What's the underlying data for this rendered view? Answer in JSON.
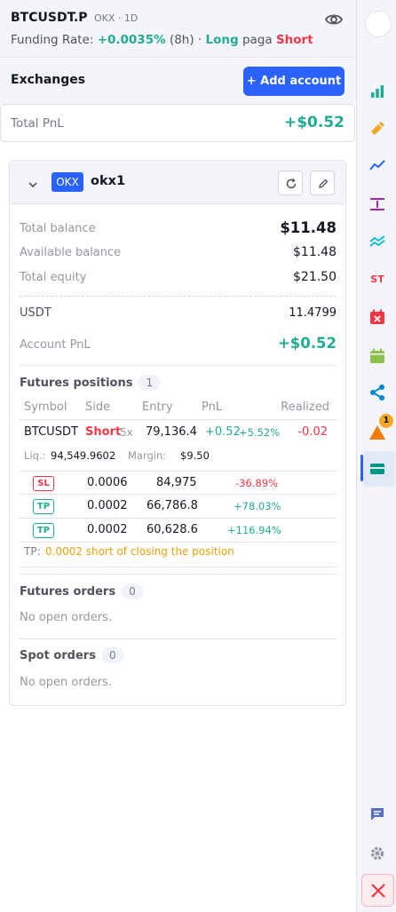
{
  "header": {
    "symbol": "BTCUSDT.P",
    "meta": "OKX · 1D",
    "funding_label": "Funding Rate:",
    "funding_rate": "+0.0035%",
    "funding_period": "(8h)",
    "dot": "·",
    "long_label": "Long",
    "pays_label": "paga",
    "short_label": "Short"
  },
  "exchanges": {
    "title": "Exchanges",
    "add_button": "+ Add account"
  },
  "total_pnl": {
    "label": "Total PnL",
    "value": "+$0.52"
  },
  "account": {
    "exchange_badge": "OKX",
    "name": "okx1",
    "rows": {
      "total_balance_label": "Total balance",
      "total_balance": "$11.48",
      "available_balance_label": "Available balance",
      "available_balance": "$11.48",
      "total_equity_label": "Total equity",
      "total_equity": "$21.50",
      "usdt_label": "USDT",
      "usdt": "11.4799",
      "account_pnl_label": "Account PnL",
      "account_pnl": "+$0.52"
    },
    "futures_positions": {
      "title": "Futures positions",
      "count": "1",
      "headers": [
        "Symbol",
        "Side",
        "Entry",
        "PnL",
        "Realized"
      ],
      "position": {
        "symbol": "BTCUSDT",
        "side": "Short",
        "leverage": "5x",
        "entry": "79,136.4",
        "pnl": "+0.52",
        "pnl_pct": "+5.52%",
        "realized": "-0.02",
        "liq_label": "Liq.:",
        "liq": "94,549.9602",
        "margin_label": "Margin:",
        "margin": "$9.50"
      },
      "orders": [
        {
          "type": "SL",
          "qty": "0.0006",
          "price": "84,975",
          "pct": "-36.89%"
        },
        {
          "type": "TP",
          "qty": "0.0002",
          "price": "66,786.8",
          "pct": "+78.03%"
        },
        {
          "type": "TP",
          "qty": "0.0002",
          "price": "60,628.6",
          "pct": "+116.94%"
        }
      ],
      "tp_note_prefix": "TP:",
      "tp_note": "0.0002 short of closing the position"
    },
    "futures_orders": {
      "title": "Futures orders",
      "count": "0",
      "empty": "No open orders."
    },
    "spot_orders": {
      "title": "Spot orders",
      "count": "0",
      "empty": "No open orders."
    }
  },
  "sidebar": {
    "st_label": "ST",
    "alert_badge": "1",
    "icons": [
      "chart-bars-icon",
      "pencil-icon",
      "line-chart-icon",
      "range-icon",
      "trend-lines-icon",
      "st-icon",
      "calendar-x-icon",
      "calendar-icon",
      "share-icon",
      "alert-icon",
      "wallet-icon",
      "chat-icon",
      "gear-icon",
      "close-icon"
    ]
  },
  "colors": {
    "accent": "#2962ff",
    "positive": "#22ab94",
    "negative": "#f23645",
    "warning": "#f5a623"
  }
}
